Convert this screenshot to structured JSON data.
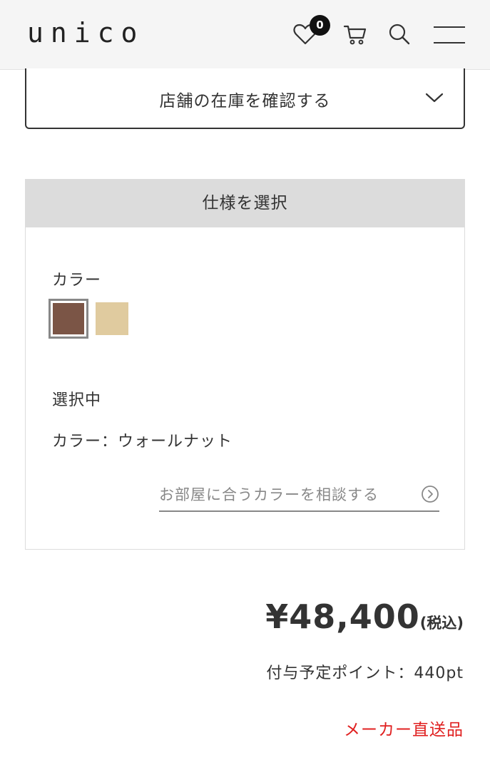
{
  "header": {
    "logo": "unico",
    "favorites_count": "0",
    "icons": [
      "heart-icon",
      "cart-icon",
      "search-icon",
      "menu-icon"
    ]
  },
  "stock": {
    "label": "店舗の在庫を確認する",
    "icon": "chevron-down-icon"
  },
  "spec": {
    "title": "仕様を選択",
    "color_label": "カラー",
    "swatches": [
      {
        "color": "#7b5546",
        "selected": true
      },
      {
        "color": "#e0cb9f",
        "selected": false
      }
    ],
    "selected_heading": "選択中",
    "selected_value": "カラー：ウォールナット",
    "consult_link": "お部屋に合うカラーを相談する"
  },
  "pricing": {
    "price": "¥48,400",
    "tax_note": "(税込)",
    "points": "付与予定ポイント：440pt",
    "shipping_note": "メーカー直送品"
  },
  "colors": {
    "header_bg": "#f5f5f5",
    "spec_header_bg": "#dcdcdc",
    "accent_red": "#e02020"
  }
}
